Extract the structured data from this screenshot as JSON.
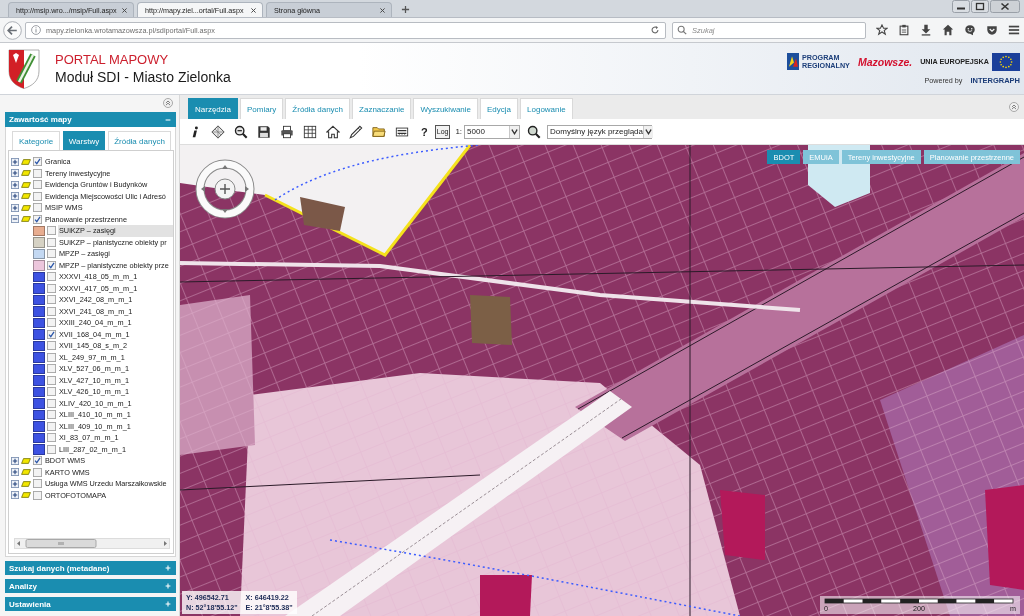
{
  "browser": {
    "tabs": [
      {
        "title": "http://msip.wro.../msip/Full.aspx",
        "selected": false
      },
      {
        "title": "http://mapy.ziel...ortal/Full.aspx",
        "selected": true
      },
      {
        "title": "Strona główna",
        "selected": false
      }
    ],
    "url": "mapy.zielonka.wrotamazowsza.pl/sdiportal/Full.aspx",
    "search": {
      "placeholder": "Szukaj"
    }
  },
  "header": {
    "title": "PORTAL MAPOWY",
    "subtitle": "Moduł SDI - Miasto Zielonka",
    "program_logo": [
      "PROGRAM",
      "REGIONALNY"
    ],
    "region_logo": "Mazowsze.",
    "eu_logo": "UNIA EUROPEJSKA",
    "powered_by": "Powered by",
    "vendor": "INTERGRAPH"
  },
  "sidebar": {
    "map_contents": {
      "title": "Zawartość mapy",
      "expanded": true,
      "tabs": [
        {
          "label": "Kategorie",
          "selected": false
        },
        {
          "label": "Warstwy",
          "selected": true
        },
        {
          "label": "Źródła danych",
          "selected": false
        }
      ],
      "layers": [
        {
          "label": "Granica",
          "checked": true,
          "expanded": false,
          "selected": false
        },
        {
          "label": "Tereny inwestycyjne",
          "checked": false,
          "expanded": false,
          "selected": false
        },
        {
          "label": "Ewidencja Gruntów i Budynków",
          "checked": false,
          "expanded": false,
          "selected": false
        },
        {
          "label": "Ewidencja Miejscowości Ulic i Adresó",
          "checked": false,
          "expanded": false,
          "selected": false
        },
        {
          "label": "MSIP WMS",
          "checked": false,
          "expanded": false,
          "selected": false
        },
        {
          "label": "Planowanie przestrzenne",
          "checked": true,
          "expanded": true,
          "selected": false,
          "children": [
            {
              "label": "SUiKZP – zasięgi",
              "checked": false,
              "selected": true,
              "color": "#e8ad90"
            },
            {
              "label": "SUiKZP – planistyczne obiekty pr",
              "checked": false,
              "selected": false,
              "color": "#d6d2c4"
            },
            {
              "label": "MPZP – zasięgi",
              "checked": false,
              "selected": false,
              "color": "#c3d8f2"
            },
            {
              "label": "MPZP – planistyczne obiekty prze",
              "checked": true,
              "selected": false,
              "color": "#ecc6dc"
            },
            {
              "label": "XXXVI_418_05_m_m_1",
              "checked": false,
              "selected": false,
              "color": "#3d52e2"
            },
            {
              "label": "XXXVI_417_05_m_m_1",
              "checked": false,
              "selected": false,
              "color": "#3d52e2"
            },
            {
              "label": "XXVI_242_08_m_m_1",
              "checked": false,
              "selected": false,
              "color": "#3d52e2"
            },
            {
              "label": "XXVI_241_08_m_m_1",
              "checked": false,
              "selected": false,
              "color": "#3d52e2"
            },
            {
              "label": "XXIII_240_04_m_m_1",
              "checked": false,
              "selected": false,
              "color": "#3d52e2"
            },
            {
              "label": "XVII_168_04_m_m_1",
              "checked": true,
              "selected": false,
              "color": "#3d52e2"
            },
            {
              "label": "XVII_145_08_s_m_2",
              "checked": false,
              "selected": false,
              "color": "#3d52e2"
            },
            {
              "label": "XL_249_97_m_m_1",
              "checked": false,
              "selected": false,
              "color": "#3d52e2"
            },
            {
              "label": "XLV_527_06_m_m_1",
              "checked": false,
              "selected": false,
              "color": "#3d52e2"
            },
            {
              "label": "XLV_427_10_m_m_1",
              "checked": false,
              "selected": false,
              "color": "#3d52e2"
            },
            {
              "label": "XLV_426_10_m_m_1",
              "checked": false,
              "selected": false,
              "color": "#3d52e2"
            },
            {
              "label": "XLIV_420_10_m_m_1",
              "checked": false,
              "selected": false,
              "color": "#3d52e2"
            },
            {
              "label": "XLIII_410_10_m_m_1",
              "checked": false,
              "selected": false,
              "color": "#3d52e2"
            },
            {
              "label": "XLIII_409_10_m_m_1",
              "checked": false,
              "selected": false,
              "color": "#3d52e2"
            },
            {
              "label": "XI_83_07_m_m_1",
              "checked": false,
              "selected": false,
              "color": "#3d52e2"
            },
            {
              "label": "LIII_287_02_m_m_1",
              "checked": false,
              "selected": false,
              "color": "#3d52e2"
            }
          ]
        },
        {
          "label": "BDOT WMS",
          "checked": true,
          "expanded": false,
          "selected": false
        },
        {
          "label": "KARTO WMS",
          "checked": false,
          "expanded": false,
          "selected": false
        },
        {
          "label": "Usługa WMS Urzedu Marszałkowskie",
          "checked": false,
          "expanded": false,
          "selected": false
        },
        {
          "label": "ORTOFOTOMAPA",
          "checked": false,
          "expanded": false,
          "selected": false
        }
      ]
    },
    "sections": [
      {
        "title": "Szukaj danych (metadane)",
        "expanded": false
      },
      {
        "title": "Analizy",
        "expanded": false
      },
      {
        "title": "Ustawienia",
        "expanded": false
      }
    ]
  },
  "map_panel": {
    "tabs": [
      {
        "label": "Narzędzia",
        "selected": true
      },
      {
        "label": "Pomiary",
        "selected": false
      },
      {
        "label": "Źródła danych",
        "selected": false
      },
      {
        "label": "Zaznaczanie",
        "selected": false
      },
      {
        "label": "Wyszukiwanie",
        "selected": false
      },
      {
        "label": "Edycja",
        "selected": false
      },
      {
        "label": "Logowanie",
        "selected": false
      }
    ],
    "toolbar": {
      "help": "?",
      "log": "Log",
      "scale_prefix": "1:",
      "scale": "5000",
      "language": "Domyślny język przegląda"
    },
    "layer_buttons": [
      {
        "label": "BDOT",
        "selected": true
      },
      {
        "label": "EMUiA",
        "selected": false
      },
      {
        "label": "Tereny inwestycyjne",
        "selected": false
      },
      {
        "label": "Planowanie przestrzenne",
        "selected": false
      }
    ],
    "coordinates": [
      "Y: 496542.71",
      "X: 646419.22",
      "N: 52°18'55.12\"",
      "E: 21°8'55.38\""
    ],
    "scale_bar": [
      "0",
      "200",
      "m"
    ]
  }
}
